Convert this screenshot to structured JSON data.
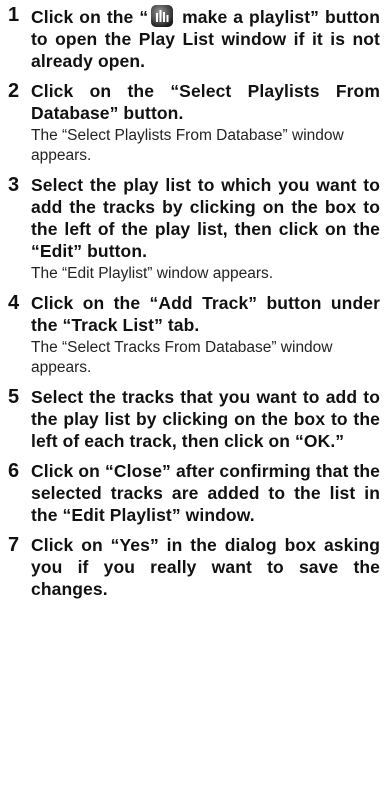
{
  "steps": [
    {
      "num": "1",
      "before_icon": "Click on the “",
      "icon": "playlist-icon",
      "after_icon": " make a playlist” button to open the Play List window if it is not already open.",
      "result": ""
    },
    {
      "num": "2",
      "text": "Click on the “Select Playlists From Database” button.",
      "result": "The “Select Playlists From Database” window appears."
    },
    {
      "num": "3",
      "text": "Select the play list to which you want to add the tracks by clicking on the box to the left of the play list, then click on the “Edit” button.",
      "result": "The “Edit Playlist” window appears."
    },
    {
      "num": "4",
      "text": "Click on the “Add Track” button under the “Track List” tab.",
      "result": "The “Select Tracks From Database” window appears."
    },
    {
      "num": "5",
      "text": "Select the tracks that you want to add to the play list by clicking on the box to the left of each track, then click on “OK.”",
      "result": ""
    },
    {
      "num": "6",
      "text": "Click on “Close” after confirming that the selected tracks are added to the list in the “Edit Playlist” window.",
      "result": ""
    },
    {
      "num": "7",
      "text": "Click on “Yes” in the dialog box asking you if you really want to save the changes.",
      "result": ""
    }
  ]
}
